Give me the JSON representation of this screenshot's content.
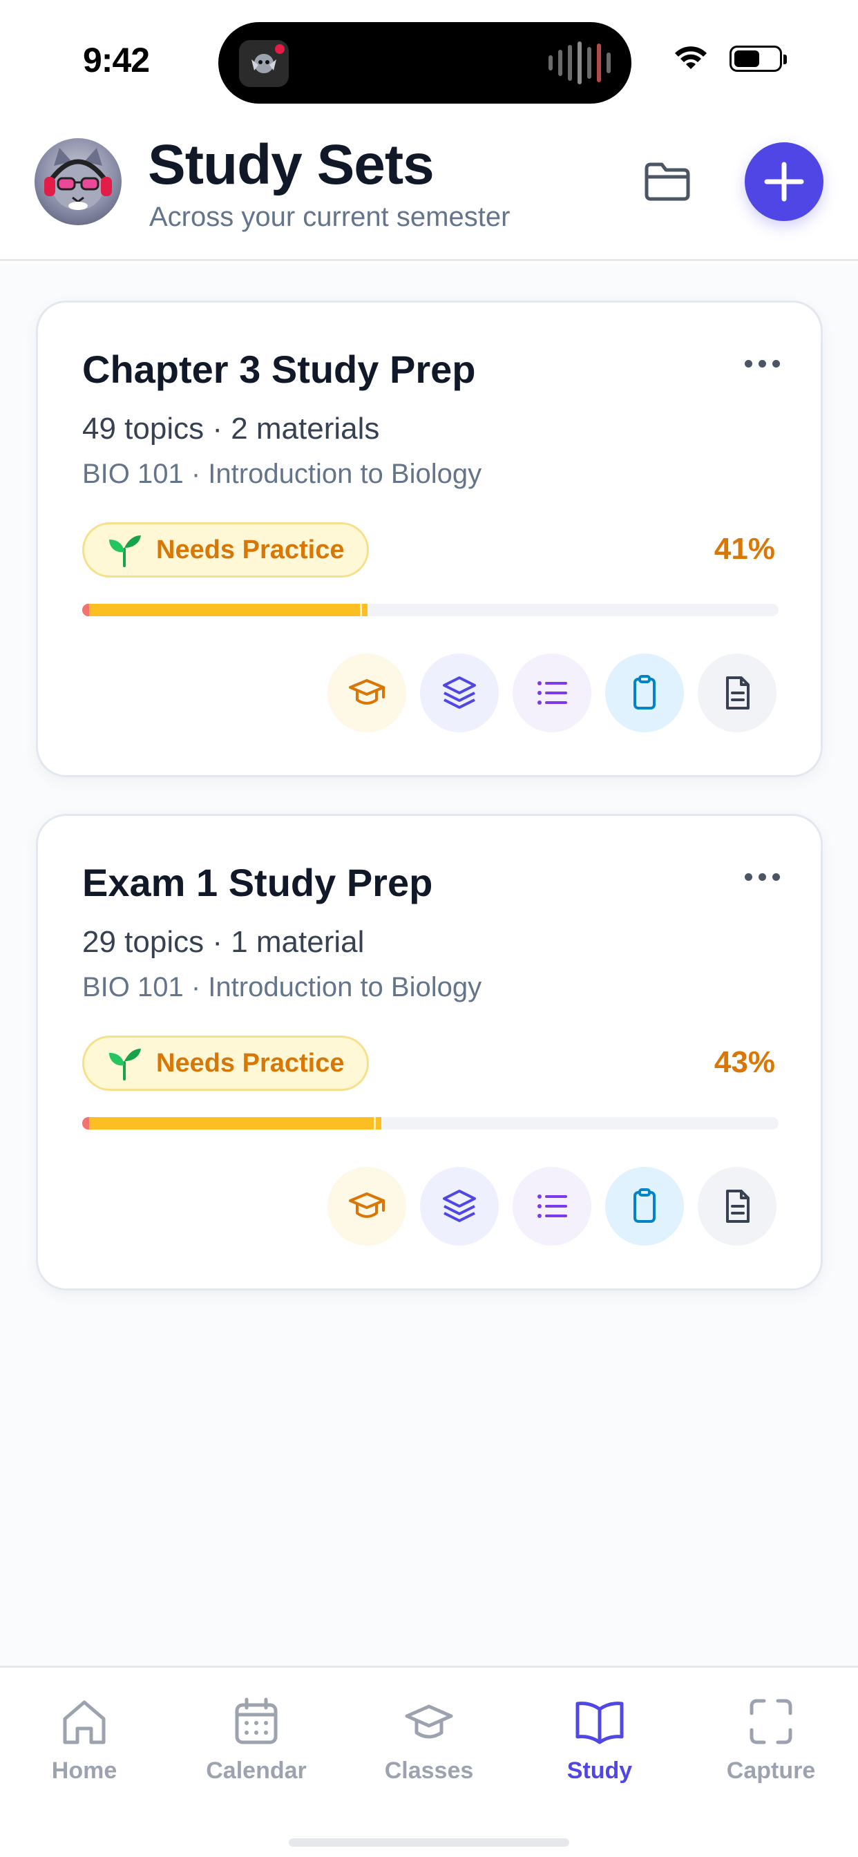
{
  "status_bar": {
    "time": "9:42"
  },
  "header": {
    "title": "Study Sets",
    "subtitle": "Across your current semester",
    "folder_icon": "folder-icon",
    "add_icon": "plus-icon",
    "accent": "#4f46e5"
  },
  "study_sets": [
    {
      "title": "Chapter 3 Study Prep",
      "meta": "49 topics · 2 materials",
      "course": "BIO 101 · Introduction to Biology",
      "status": "Needs Practice",
      "percent_label": "41%",
      "progress": 0.41
    },
    {
      "title": "Exam 1 Study Prep",
      "meta": "29 topics · 1 material",
      "course": "BIO 101 · Introduction to Biology",
      "status": "Needs Practice",
      "percent_label": "43%",
      "progress": 0.43
    }
  ],
  "card_actions": [
    "graduation-cap-icon",
    "layers-icon",
    "list-icon",
    "clipboard-icon",
    "document-icon"
  ],
  "status_colors": {
    "needs_practice": "#d97706",
    "progress_bar": "#fbbf24"
  },
  "tabs": [
    {
      "label": "Home",
      "icon": "home-icon",
      "active": false
    },
    {
      "label": "Calendar",
      "icon": "calendar-icon",
      "active": false
    },
    {
      "label": "Classes",
      "icon": "graduation-cap-icon",
      "active": false
    },
    {
      "label": "Study",
      "icon": "book-open-icon",
      "active": true
    },
    {
      "label": "Capture",
      "icon": "scan-icon",
      "active": false
    }
  ]
}
